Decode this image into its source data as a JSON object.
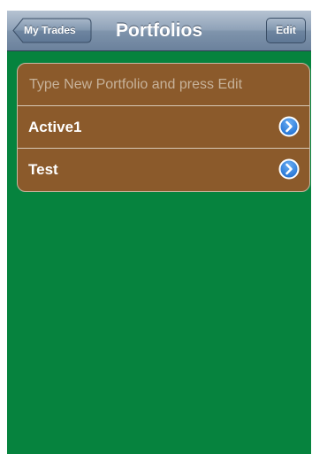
{
  "navbar": {
    "title": "Portfolios",
    "back_label": "My Trades",
    "edit_label": "Edit"
  },
  "new_portfolio": {
    "placeholder": "Type New Portfolio and press Edit",
    "value": ""
  },
  "portfolios": [
    {
      "name": "Active1",
      "accessory": "detail-disclosure-icon"
    },
    {
      "name": "Test",
      "accessory": "detail-disclosure-icon"
    }
  ],
  "colors": {
    "background": "#06833e",
    "cell": "#8b5a2b",
    "navbar": "#8fa2b8",
    "disclosure": "#2a7bdc"
  }
}
